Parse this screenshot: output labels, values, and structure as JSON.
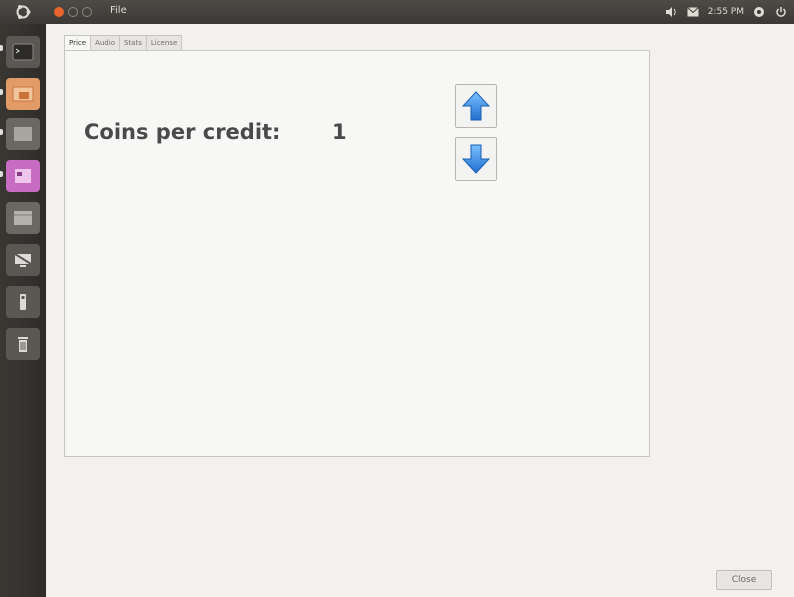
{
  "top_panel": {
    "menu_file": "File",
    "clock": "2:55 PM",
    "icons": [
      "volume-icon",
      "mail-icon",
      "settings-icon",
      "power-icon"
    ]
  },
  "launcher": {
    "items": [
      "terminal-icon",
      "photos-icon",
      "app-icon",
      "app-pink-icon",
      "files-icon",
      "display-icon",
      "usb-icon",
      "trash-icon"
    ]
  },
  "tabs": [
    {
      "label": "Price",
      "active": true
    },
    {
      "label": "Audio",
      "active": false
    },
    {
      "label": "Stats",
      "active": false
    },
    {
      "label": "License",
      "active": false
    }
  ],
  "main": {
    "coins_label": "Coins per credit:",
    "coins_value": "1",
    "up_icon": "arrow-up-icon",
    "down_icon": "arrow-down-icon"
  },
  "footer": {
    "close_label": "Close"
  },
  "colors": {
    "accent_orange": "#e8642c",
    "arrow_blue": "#3b8ee6"
  }
}
